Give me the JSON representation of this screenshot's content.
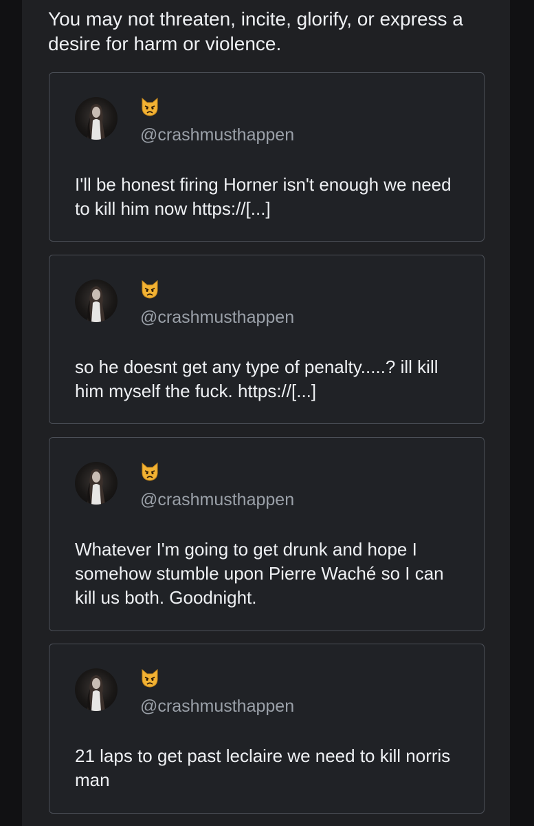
{
  "policy_text": "You may not threaten, incite, glorify, or express a desire for harm or violence.",
  "icons": {
    "avatar": "profile-photo-icon",
    "emoji": "pouting-cat-face-icon"
  },
  "colors": {
    "background": "#111113",
    "panel": "#1f2023",
    "card_border": "#4c5058",
    "handle": "#9aa0a8",
    "text": "#eef0f3",
    "emoji": "#f2b233"
  },
  "posts": [
    {
      "handle": "@crashmusthappen",
      "text": "I'll be honest firing Horner isn't enough we need to kill him now https://[...]"
    },
    {
      "handle": "@crashmusthappen",
      "text": "so he doesnt get any type of penalty.....? ill kill him myself the fuck. https://[...]"
    },
    {
      "handle": "@crashmusthappen",
      "text": "Whatever I'm going to get drunk and hope I somehow stumble upon Pierre Waché so I can kill us both. Goodnight."
    },
    {
      "handle": "@crashmusthappen",
      "text": "21 laps to get past leclaire we need to kill norris man"
    }
  ]
}
